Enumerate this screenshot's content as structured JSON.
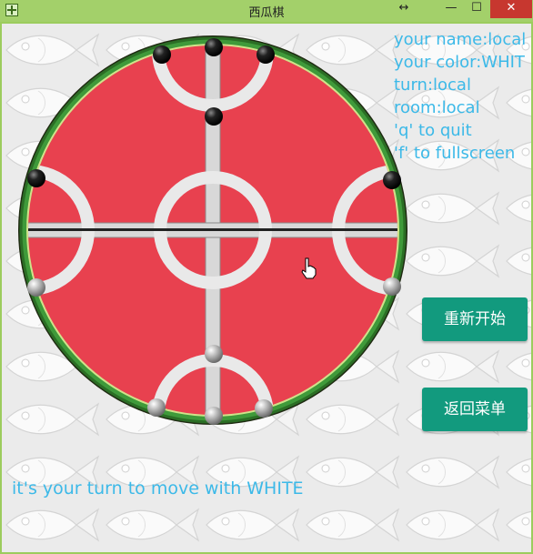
{
  "window": {
    "title": "西瓜棋",
    "resize_glyph": "↔",
    "min_glyph": "—",
    "max_glyph": "☐",
    "close_glyph": "✕"
  },
  "info": {
    "name_line": "your name:local",
    "color_line": "your color:WHIT",
    "turn_line": "turn:local",
    "room_line": "room:local",
    "quit_line": "'q' to quit",
    "fullscreen_line": "'f' to fullscreen"
  },
  "buttons": {
    "restart": "重新开始",
    "back_menu": "返回菜单"
  },
  "status": "it's your turn to move with WHITE",
  "colors": {
    "accent": "#3cb9e8",
    "button": "#129a7e",
    "board_red": "#e8414f",
    "rind_green": "#2e8b2e",
    "title_bar": "#a3d06a"
  },
  "game": {
    "black_pieces": 6,
    "white_pieces": 6,
    "black_positions": [
      "top-left-arc",
      "top-center",
      "top-right-arc",
      "upper-center",
      "left-upper",
      "right-upper"
    ],
    "white_positions": [
      "left-lower",
      "right-lower",
      "lower-center",
      "bottom-left-arc",
      "bottom-center",
      "bottom-right-arc"
    ]
  }
}
